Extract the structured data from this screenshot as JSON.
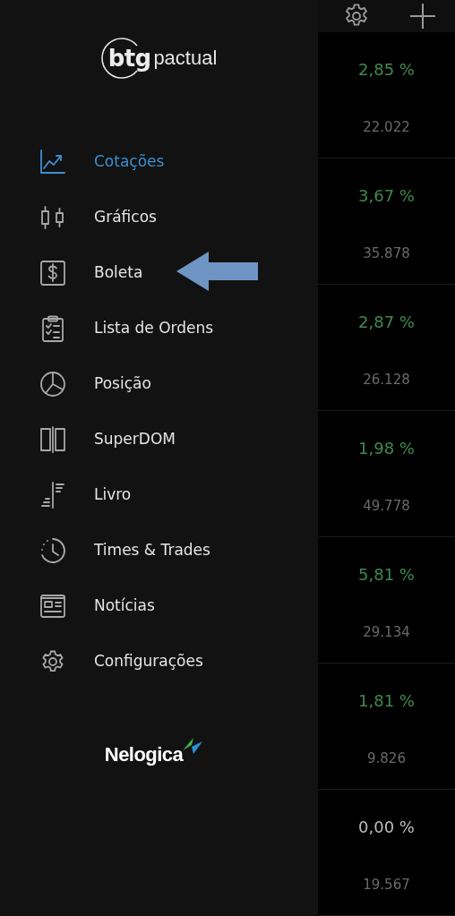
{
  "drawer": {
    "brand_logo": {
      "primary": "btg",
      "secondary": "pactual"
    },
    "items": [
      {
        "label": "Cotações",
        "selected": true
      },
      {
        "label": "Gráficos",
        "selected": false
      },
      {
        "label": "Boleta",
        "selected": false
      },
      {
        "label": "Lista de Ordens",
        "selected": false
      },
      {
        "label": "Posição",
        "selected": false
      },
      {
        "label": "SuperDOM",
        "selected": false
      },
      {
        "label": "Livro",
        "selected": false
      },
      {
        "label": "Times & Trades",
        "selected": false
      },
      {
        "label": "Notícias",
        "selected": false
      },
      {
        "label": "Configurações",
        "selected": false
      }
    ],
    "footer_logo": "Nelogica"
  },
  "quotes": [
    {
      "change": "2,85 %",
      "volume": "22.022",
      "color": "#3f8a4f"
    },
    {
      "change": "3,67 %",
      "volume": "35.878",
      "color": "#3f8a4f"
    },
    {
      "change": "2,87 %",
      "volume": "26.128",
      "color": "#3f8a4f"
    },
    {
      "change": "1,98 %",
      "volume": "49.778",
      "color": "#3f8a4f"
    },
    {
      "change": "5,81 %",
      "volume": "29.134",
      "color": "#3f8a4f"
    },
    {
      "change": "1,81 %",
      "volume": "9.826",
      "color": "#3f8a4f"
    },
    {
      "change": "0,00 %",
      "volume": "19.567",
      "color": "#bdbdbd"
    }
  ]
}
